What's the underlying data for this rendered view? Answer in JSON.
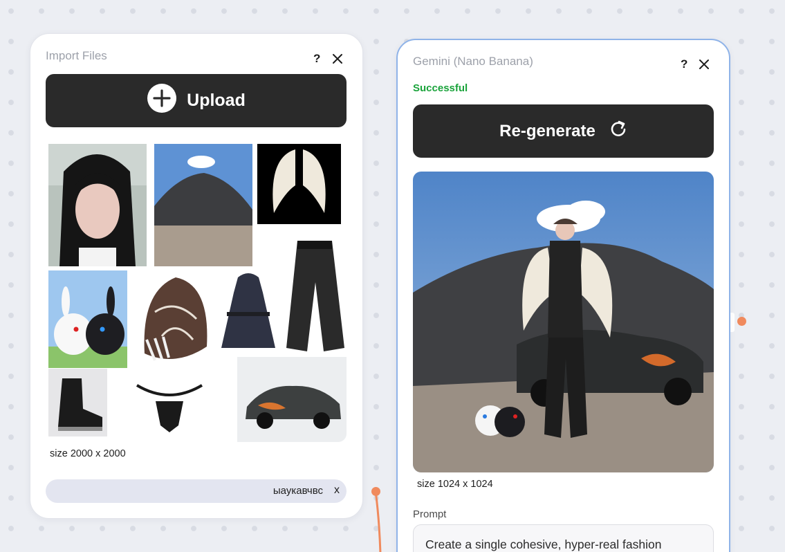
{
  "import_node": {
    "title": "Import Files",
    "help_label": "?",
    "upload_label": "Upload",
    "size_label": "size 2000 x 2000",
    "tag_text": "ыаукавчвс",
    "tag_remove": "x",
    "thumbnails": [
      {
        "name": "portrait-photo"
      },
      {
        "name": "dark-mountain-photo"
      },
      {
        "name": "angel-wings-photo"
      },
      {
        "name": "leather-pants-photo"
      },
      {
        "name": "rabbits-photo"
      },
      {
        "name": "cap-photo"
      },
      {
        "name": "jacket-photo"
      },
      {
        "name": "boot-photo"
      },
      {
        "name": "harness-photo"
      },
      {
        "name": "hot-rod-car-photo"
      }
    ]
  },
  "gemini_node": {
    "title": "Gemini (Nano Banana)",
    "help_label": "?",
    "status": "Successful",
    "regenerate_label": "Re-generate",
    "size_label": "size 1024 x 1024",
    "prompt_label": "Prompt",
    "prompt_text": "Create a single cohesive, hyper-real fashion",
    "output_index": "1"
  },
  "colors": {
    "accent_border": "#8fb3e8",
    "success": "#1aa33b",
    "button_dark": "#2a2a2a",
    "connector": "#f08a5d"
  }
}
